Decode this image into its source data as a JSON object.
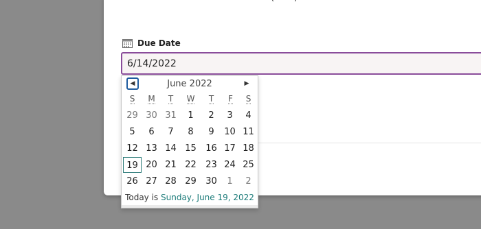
{
  "dialog": {
    "top_text": "(... ...)"
  },
  "due_date": {
    "icon": "calendar-icon",
    "label": "Due Date",
    "value": "6/14/2022"
  },
  "datepicker": {
    "month_title": "June 2022",
    "prev_icon": "triangle-left-icon",
    "next_icon": "triangle-right-icon",
    "weekdays": [
      "S",
      "M",
      "T",
      "W",
      "T",
      "F",
      "S"
    ],
    "weeks": [
      [
        {
          "d": "29",
          "other": true
        },
        {
          "d": "30",
          "other": true
        },
        {
          "d": "31",
          "other": true
        },
        {
          "d": "1"
        },
        {
          "d": "2"
        },
        {
          "d": "3"
        },
        {
          "d": "4"
        }
      ],
      [
        {
          "d": "5"
        },
        {
          "d": "6"
        },
        {
          "d": "7"
        },
        {
          "d": "8"
        },
        {
          "d": "9"
        },
        {
          "d": "10"
        },
        {
          "d": "11"
        }
      ],
      [
        {
          "d": "12"
        },
        {
          "d": "13"
        },
        {
          "d": "14"
        },
        {
          "d": "15"
        },
        {
          "d": "16"
        },
        {
          "d": "17"
        },
        {
          "d": "18"
        }
      ],
      [
        {
          "d": "19",
          "today": true
        },
        {
          "d": "20"
        },
        {
          "d": "21"
        },
        {
          "d": "22"
        },
        {
          "d": "23"
        },
        {
          "d": "24"
        },
        {
          "d": "25"
        }
      ],
      [
        {
          "d": "26"
        },
        {
          "d": "27"
        },
        {
          "d": "28"
        },
        {
          "d": "29"
        },
        {
          "d": "30"
        },
        {
          "d": "1",
          "other": true
        },
        {
          "d": "2",
          "other": true
        }
      ]
    ],
    "footer_prefix": "Today is",
    "footer_today": "Sunday, June 19, 2022"
  },
  "colors": {
    "input_border": "#8a4c9a",
    "today_link": "#1a7a78",
    "nav_focus": "#1f5c9f"
  }
}
